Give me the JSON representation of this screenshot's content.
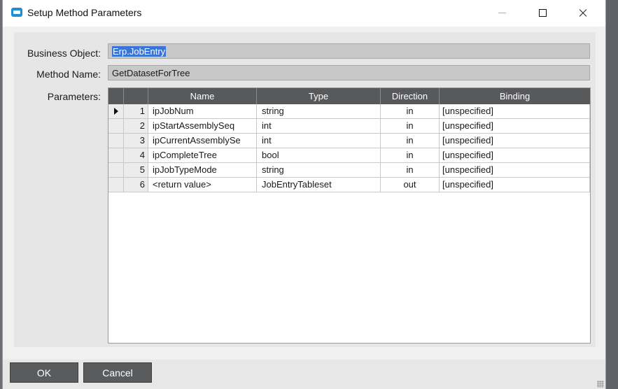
{
  "window": {
    "title": "Setup Method Parameters"
  },
  "form": {
    "business_object_label": "Business Object:",
    "business_object_value": "Erp.JobEntry",
    "method_name_label": "Method Name:",
    "method_name_value": "GetDatasetForTree",
    "parameters_label": "Parameters:"
  },
  "grid": {
    "columns": [
      "Name",
      "Type",
      "Direction",
      "Binding"
    ],
    "rows": [
      {
        "num": "1",
        "name": "ipJobNum",
        "type": "string",
        "direction": "in",
        "binding": "[unspecified]"
      },
      {
        "num": "2",
        "name": "ipStartAssemblySeq",
        "type": "int",
        "direction": "in",
        "binding": "[unspecified]"
      },
      {
        "num": "3",
        "name": "ipCurrentAssemblySe",
        "type": "int",
        "direction": "in",
        "binding": "[unspecified]"
      },
      {
        "num": "4",
        "name": "ipCompleteTree",
        "type": "bool",
        "direction": "in",
        "binding": "[unspecified]"
      },
      {
        "num": "5",
        "name": "ipJobTypeMode",
        "type": "string",
        "direction": "in",
        "binding": "[unspecified]"
      },
      {
        "num": "6",
        "name": "<return value>",
        "type": "JobEntryTableset",
        "direction": "out",
        "binding": "[unspecified]"
      }
    ]
  },
  "buttons": {
    "ok": "OK",
    "cancel": "Cancel"
  },
  "icons": {
    "app": "dialog-icon",
    "current_row": "row-pointer-icon"
  },
  "colors": {
    "header_bg": "#58595b",
    "selection": "#3a74d4",
    "button_bg": "#5a5b5d",
    "app_icon": "#1f8fd6"
  }
}
